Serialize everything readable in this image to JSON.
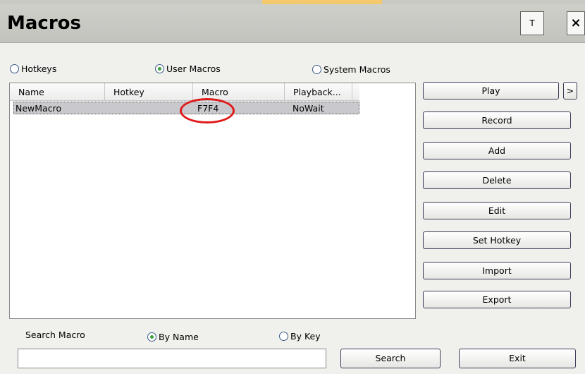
{
  "window": {
    "title": "Macros",
    "pin_label": "T",
    "close_label": "×"
  },
  "mode": {
    "options": [
      {
        "label": "Hotkeys",
        "selected": false
      },
      {
        "label": "User Macros",
        "selected": true
      },
      {
        "label": "System Macros",
        "selected": false
      }
    ]
  },
  "table": {
    "columns": [
      "Name",
      "Hotkey",
      "Macro",
      "Playback..."
    ],
    "rows": [
      {
        "name": "NewMacro",
        "hotkey": "",
        "macro": "F7F4",
        "playback": "NoWait"
      }
    ],
    "highlight_color": "#e01a1a"
  },
  "actions": {
    "play": "Play",
    "more": ">",
    "record": "Record",
    "add": "Add",
    "delete": "Delete",
    "edit": "Edit",
    "set_hotkey": "Set Hotkey",
    "import": "Import",
    "export": "Export"
  },
  "search": {
    "label": "Search Macro",
    "options": [
      {
        "label": "By Name",
        "selected": true
      },
      {
        "label": "By Key",
        "selected": false
      }
    ],
    "value": "",
    "button": "Search",
    "exit": "Exit"
  }
}
